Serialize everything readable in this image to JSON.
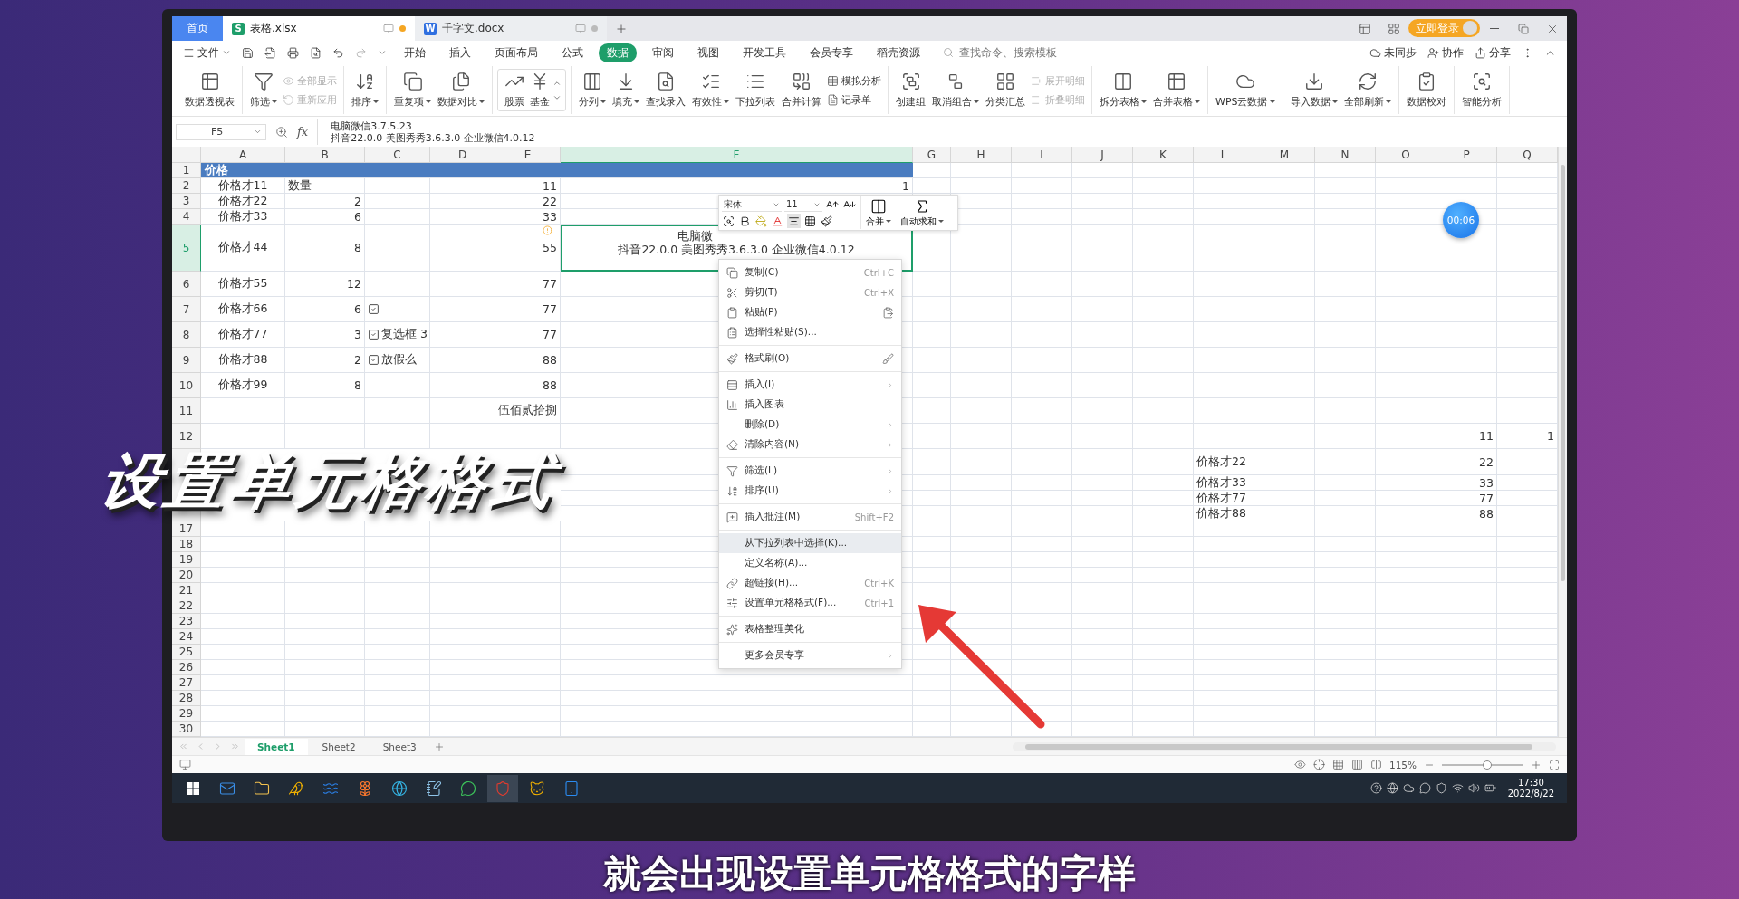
{
  "title_bar": {
    "tabs": [
      {
        "label": "首页",
        "kind": "home",
        "selected": false
      },
      {
        "label": "表格.xlsx",
        "kind": "doc",
        "badge": "S",
        "selected": true
      },
      {
        "label": "千字文.docx",
        "kind": "doc",
        "badge": "W",
        "selected": false
      }
    ],
    "login_button": "立即登录"
  },
  "menu_bar": {
    "file_label": "文件",
    "tabs": [
      {
        "label": "开始",
        "selected": false
      },
      {
        "label": "插入",
        "selected": false
      },
      {
        "label": "页面布局",
        "selected": false
      },
      {
        "label": "公式",
        "selected": false
      },
      {
        "label": "数据",
        "selected": true
      },
      {
        "label": "审阅",
        "selected": false
      },
      {
        "label": "视图",
        "selected": false
      },
      {
        "label": "开发工具",
        "selected": false
      },
      {
        "label": "会员专享",
        "selected": false
      },
      {
        "label": "稻壳资源",
        "selected": false
      }
    ],
    "search": {
      "placeholder": "查找命令、搜索模板"
    },
    "actions": [
      "未同步",
      "协作",
      "分享"
    ]
  },
  "ribbon": {
    "groups": [
      {
        "kind": "plain",
        "items": [
          {
            "label": "数据透视表",
            "kind": "large",
            "dropdown": false,
            "disabled": false
          }
        ]
      },
      {
        "kind": "plain",
        "items": [
          {
            "label": "筛选",
            "kind": "large",
            "dropdown": true,
            "disabled": false
          },
          {
            "label": "全部显示",
            "kind": "small",
            "dropdown": false,
            "disabled": true
          },
          {
            "label": "重新应用",
            "kind": "small",
            "dropdown": false,
            "disabled": true
          }
        ]
      },
      {
        "kind": "plain",
        "items": [
          {
            "label": "排序",
            "kind": "large",
            "dropdown": true,
            "disabled": false
          }
        ]
      },
      {
        "kind": "plain",
        "items": [
          {
            "label": "重复项",
            "kind": "large",
            "dropdown": true,
            "disabled": false
          },
          {
            "label": "数据对比",
            "kind": "large",
            "dropdown": true,
            "disabled": false
          }
        ]
      },
      {
        "kind": "gallery",
        "items": [
          {
            "label": "股票",
            "kind": "large",
            "dropdown": false,
            "disabled": false
          },
          {
            "label": "基金",
            "kind": "large",
            "dropdown": false,
            "disabled": false
          }
        ]
      },
      {
        "kind": "plain",
        "items": [
          {
            "label": "分列",
            "kind": "large",
            "dropdown": true,
            "disabled": false
          },
          {
            "label": "填充",
            "kind": "large",
            "dropdown": true,
            "disabled": false
          },
          {
            "label": "查找录入",
            "kind": "large",
            "dropdown": false,
            "disabled": false
          },
          {
            "label": "有效性",
            "kind": "large",
            "dropdown": true,
            "disabled": false
          },
          {
            "label": "下拉列表",
            "kind": "large",
            "dropdown": false,
            "disabled": false
          },
          {
            "label": "合并计算",
            "kind": "large",
            "dropdown": false,
            "disabled": false
          },
          {
            "label": "模拟分析",
            "kind": "small",
            "dropdown": false,
            "disabled": false
          },
          {
            "label": "记录单",
            "kind": "small",
            "dropdown": false,
            "disabled": false
          }
        ]
      },
      {
        "kind": "plain",
        "items": [
          {
            "label": "创建组",
            "kind": "large",
            "dropdown": false,
            "disabled": false
          },
          {
            "label": "取消组合",
            "kind": "large",
            "dropdown": true,
            "disabled": false
          },
          {
            "label": "分类汇总",
            "kind": "large",
            "dropdown": false,
            "disabled": false
          },
          {
            "label": "展开明细",
            "kind": "small",
            "dropdown": false,
            "disabled": true
          },
          {
            "label": "折叠明细",
            "kind": "small",
            "dropdown": false,
            "disabled": true
          }
        ]
      },
      {
        "kind": "plain",
        "items": [
          {
            "label": "拆分表格",
            "kind": "large",
            "dropdown": true,
            "disabled": false
          },
          {
            "label": "合并表格",
            "kind": "large",
            "dropdown": true,
            "disabled": false
          }
        ]
      },
      {
        "kind": "plain",
        "items": [
          {
            "label": "WPS云数据",
            "kind": "large",
            "dropdown": true,
            "disabled": false
          }
        ]
      },
      {
        "kind": "plain",
        "items": [
          {
            "label": "导入数据",
            "kind": "large",
            "dropdown": true,
            "disabled": false
          },
          {
            "label": "全部刷新",
            "kind": "large",
            "dropdown": true,
            "disabled": false
          }
        ]
      },
      {
        "kind": "plain",
        "items": [
          {
            "label": "数据校对",
            "kind": "large",
            "dropdown": false,
            "disabled": false
          }
        ]
      },
      {
        "kind": "plain",
        "items": [
          {
            "label": "智能分析",
            "kind": "large",
            "dropdown": false,
            "disabled": false
          }
        ]
      }
    ]
  },
  "formula_bar": {
    "cell_ref": "F5",
    "fx": "fx",
    "lines": [
      "电脑微信3.7.5.23",
      "抖音22.0.0 美图秀秀3.6.3.0 企业微信4.0.12"
    ]
  },
  "sheet": {
    "columns": [
      {
        "label": "A",
        "selected": false
      },
      {
        "label": "B",
        "selected": false
      },
      {
        "label": "C",
        "selected": false
      },
      {
        "label": "D",
        "selected": false
      },
      {
        "label": "E",
        "selected": false
      },
      {
        "label": "F",
        "selected": true
      },
      {
        "label": "G",
        "selected": false
      },
      {
        "label": "H",
        "selected": false
      },
      {
        "label": "I",
        "selected": false
      },
      {
        "label": "J",
        "selected": false
      },
      {
        "label": "K",
        "selected": false
      },
      {
        "label": "L",
        "selected": false
      },
      {
        "label": "M",
        "selected": false
      },
      {
        "label": "N",
        "selected": false
      },
      {
        "label": "O",
        "selected": false
      },
      {
        "label": "P",
        "selected": false
      },
      {
        "label": "Q",
        "selected": false
      }
    ],
    "rows": [
      {
        "number": "1",
        "selected": false,
        "cells": [
          {
            "kind": "banner",
            "text": "价格"
          }
        ]
      },
      {
        "number": "2",
        "selected": false,
        "cells": [
          {
            "kind": "label",
            "text": "价格才11"
          },
          {
            "kind": "text",
            "text": "数量"
          },
          {
            "kind": "empty"
          },
          {
            "kind": "empty"
          },
          {
            "kind": "number",
            "text": "11"
          },
          {
            "kind": "number",
            "text": "1"
          }
        ]
      },
      {
        "number": "3",
        "selected": false,
        "cells": [
          {
            "kind": "label",
            "text": "价格才22"
          },
          {
            "kind": "number",
            "text": "2"
          },
          {
            "kind": "empty"
          },
          {
            "kind": "empty"
          },
          {
            "kind": "number",
            "text": "22"
          }
        ]
      },
      {
        "number": "4",
        "selected": false,
        "cells": [
          {
            "kind": "label",
            "text": "价格才33"
          },
          {
            "kind": "number",
            "text": "6"
          },
          {
            "kind": "empty"
          },
          {
            "kind": "empty"
          },
          {
            "kind": "number",
            "text": "33"
          }
        ]
      },
      {
        "number": "5",
        "selected": true,
        "cells": [
          {
            "kind": "label",
            "text": "价格才44"
          },
          {
            "kind": "number",
            "text": "8"
          },
          {
            "kind": "empty"
          },
          {
            "kind": "empty"
          },
          {
            "kind": "number",
            "text": "55",
            "warning": true
          },
          {
            "kind": "multiline",
            "lines": [
              "电脑微",
              "抖音22.0.0 美图秀秀3.6.3.0 企业微信4.0.12"
            ]
          }
        ]
      },
      {
        "number": "6",
        "selected": false,
        "cells": [
          {
            "kind": "label",
            "text": "价格才55"
          },
          {
            "kind": "number",
            "text": "12"
          },
          {
            "kind": "empty"
          },
          {
            "kind": "empty"
          },
          {
            "kind": "number",
            "text": "77"
          }
        ]
      },
      {
        "number": "7",
        "selected": false,
        "cells": [
          {
            "kind": "label",
            "text": "价格才66"
          },
          {
            "kind": "number",
            "text": "6"
          },
          {
            "kind": "checkbox",
            "checked": true
          },
          {
            "kind": "empty"
          },
          {
            "kind": "number",
            "text": "77"
          }
        ]
      },
      {
        "number": "8",
        "selected": false,
        "cells": [
          {
            "kind": "label",
            "text": "价格才77"
          },
          {
            "kind": "number",
            "text": "3"
          },
          {
            "kind": "checkbox",
            "checked": true,
            "text": "复选框 3"
          },
          {
            "kind": "empty"
          },
          {
            "kind": "number",
            "text": "77"
          }
        ]
      },
      {
        "number": "9",
        "selected": false,
        "cells": [
          {
            "kind": "label",
            "text": "价格才88"
          },
          {
            "kind": "number",
            "text": "2"
          },
          {
            "kind": "checkbox",
            "checked": true,
            "text": "放假么"
          },
          {
            "kind": "empty"
          },
          {
            "kind": "number",
            "text": "88"
          }
        ]
      },
      {
        "number": "10",
        "selected": false,
        "cells": [
          {
            "kind": "label",
            "text": "价格才99"
          },
          {
            "kind": "number",
            "text": "8"
          },
          {
            "kind": "empty"
          },
          {
            "kind": "empty"
          },
          {
            "kind": "number",
            "text": "88"
          }
        ]
      },
      {
        "number": "11",
        "selected": false,
        "cells": [
          {
            "kind": "empty"
          },
          {
            "kind": "empty"
          },
          {
            "kind": "empty"
          },
          {
            "kind": "empty"
          },
          {
            "kind": "number",
            "text": "伍佰贰拾捌"
          }
        ]
      },
      {
        "number": "12",
        "selected": false,
        "cells": [
          {
            "kind": "empty"
          },
          {
            "kind": "empty"
          },
          {
            "kind": "empty"
          },
          {
            "kind": "empty"
          },
          {
            "kind": "empty"
          },
          {
            "kind": "empty"
          },
          {
            "kind": "empty"
          },
          {
            "kind": "empty"
          },
          {
            "kind": "empty"
          },
          {
            "kind": "empty"
          },
          {
            "kind": "empty"
          },
          {
            "kind": "empty"
          },
          {
            "kind": "empty"
          },
          {
            "kind": "empty"
          },
          {
            "kind": "empty"
          },
          {
            "kind": "number",
            "text": "11"
          },
          {
            "kind": "number",
            "text": "1"
          }
        ]
      },
      {
        "selected": false,
        "cells": [
          {
            "kind": "empty"
          },
          {
            "kind": "empty"
          },
          {
            "kind": "empty"
          },
          {
            "kind": "empty"
          },
          {
            "kind": "empty"
          },
          {
            "kind": "empty"
          },
          {
            "kind": "empty"
          },
          {
            "kind": "empty"
          },
          {
            "kind": "empty"
          },
          {
            "kind": "empty"
          },
          {
            "kind": "empty"
          },
          {
            "kind": "text",
            "text": "价格才22"
          },
          {
            "kind": "empty"
          },
          {
            "kind": "empty"
          },
          {
            "kind": "empty"
          },
          {
            "kind": "number",
            "text": "22"
          }
        ]
      },
      {
        "selected": false,
        "cells": [
          {
            "kind": "empty"
          },
          {
            "kind": "empty"
          },
          {
            "kind": "empty"
          },
          {
            "kind": "empty"
          },
          {
            "kind": "empty"
          },
          {
            "kind": "empty"
          },
          {
            "kind": "empty"
          },
          {
            "kind": "empty"
          },
          {
            "kind": "empty"
          },
          {
            "kind": "empty"
          },
          {
            "kind": "empty"
          },
          {
            "kind": "text",
            "text": "价格才33"
          },
          {
            "kind": "empty"
          },
          {
            "kind": "empty"
          },
          {
            "kind": "empty"
          },
          {
            "kind": "number",
            "text": "33"
          }
        ]
      },
      {
        "selected": false,
        "cells": [
          {
            "kind": "empty"
          },
          {
            "kind": "empty"
          },
          {
            "kind": "empty"
          },
          {
            "kind": "empty"
          },
          {
            "kind": "empty"
          },
          {
            "kind": "empty"
          },
          {
            "kind": "empty"
          },
          {
            "kind": "empty"
          },
          {
            "kind": "empty"
          },
          {
            "kind": "empty"
          },
          {
            "kind": "empty"
          },
          {
            "kind": "text",
            "text": "价格才77"
          },
          {
            "kind": "empty"
          },
          {
            "kind": "empty"
          },
          {
            "kind": "empty"
          },
          {
            "kind": "number",
            "text": "77"
          }
        ]
      },
      {
        "selected": false,
        "cells": [
          {
            "kind": "empty"
          },
          {
            "kind": "empty"
          },
          {
            "kind": "empty"
          },
          {
            "kind": "empty"
          },
          {
            "kind": "empty"
          },
          {
            "kind": "empty"
          },
          {
            "kind": "empty"
          },
          {
            "kind": "empty"
          },
          {
            "kind": "empty"
          },
          {
            "kind": "empty"
          },
          {
            "kind": "empty"
          },
          {
            "kind": "text",
            "text": "价格才88"
          },
          {
            "kind": "empty"
          },
          {
            "kind": "empty"
          },
          {
            "kind": "empty"
          },
          {
            "kind": "number",
            "text": "88"
          }
        ]
      },
      {
        "number": "17",
        "selected": false,
        "cells": []
      },
      {
        "number": "18",
        "selected": false,
        "cells": []
      },
      {
        "number": "19",
        "selected": false,
        "cells": []
      },
      {
        "number": "20",
        "selected": false,
        "cells": []
      },
      {
        "number": "21",
        "selected": false,
        "cells": []
      },
      {
        "number": "22",
        "selected": false,
        "cells": []
      },
      {
        "number": "23",
        "selected": false,
        "cells": []
      },
      {
        "number": "24",
        "selected": false,
        "cells": []
      },
      {
        "number": "25",
        "selected": false,
        "cells": []
      },
      {
        "number": "26",
        "selected": false,
        "cells": []
      },
      {
        "number": "27",
        "selected": false,
        "cells": []
      },
      {
        "number": "28",
        "selected": false,
        "cells": []
      },
      {
        "number": "29",
        "selected": false,
        "cells": []
      },
      {
        "number": "30",
        "selected": false,
        "cells": []
      }
    ]
  },
  "mini_toolbar": {
    "font": "宋体",
    "size": "11",
    "merge": "合并",
    "autosum": "自动求和"
  },
  "context_menu": {
    "sections": [
      [
        {
          "label": "复制(C)",
          "shortcut": "Ctrl+C",
          "submenu": false,
          "selected": false
        },
        {
          "label": "剪切(T)",
          "shortcut": "Ctrl+X",
          "submenu": false,
          "selected": false
        },
        {
          "label": "粘贴(P)",
          "submenu": false,
          "selected": false
        },
        {
          "label": "选择性粘贴(S)...",
          "submenu": false,
          "selected": false
        }
      ],
      [
        {
          "label": "格式刷(O)",
          "submenu": false,
          "selected": false
        }
      ],
      [
        {
          "label": "插入(I)",
          "submenu": true,
          "selected": false
        },
        {
          "label": "插入图表",
          "submenu": false,
          "selected": false
        },
        {
          "label": "删除(D)",
          "submenu": true,
          "selected": false
        },
        {
          "label": "清除内容(N)",
          "submenu": true,
          "selected": false
        }
      ],
      [
        {
          "label": "筛选(L)",
          "submenu": true,
          "selected": false
        },
        {
          "label": "排序(U)",
          "submenu": true,
          "selected": false
        }
      ],
      [
        {
          "label": "插入批注(M)",
          "shortcut": "Shift+F2",
          "submenu": false,
          "selected": false
        }
      ],
      [
        {
          "label": "从下拉列表中选择(K)...",
          "submenu": false,
          "selected": true
        },
        {
          "label": "定义名称(A)...",
          "submenu": false,
          "selected": false
        },
        {
          "label": "超链接(H)...",
          "shortcut": "Ctrl+K",
          "submenu": false,
          "selected": false
        },
        {
          "label": "设置单元格格式(F)...",
          "shortcut": "Ctrl+1",
          "submenu": false,
          "selected": false
        }
      ],
      [
        {
          "label": "表格整理美化",
          "submenu": false,
          "selected": false
        }
      ],
      [
        {
          "label": "更多会员专享",
          "submenu": true,
          "selected": false
        }
      ]
    ]
  },
  "timer": "00:06",
  "sheet_tabs": [
    {
      "label": "Sheet1",
      "selected": true
    },
    {
      "label": "Sheet2",
      "selected": false
    },
    {
      "label": "Sheet3",
      "selected": false
    }
  ],
  "status_bar": {
    "zoom": "115%",
    "level": 0.55
  },
  "taskbar": {
    "time": "17:30",
    "date": "2022/8/22"
  },
  "caption_overlay": "设置单元格格式",
  "subtitle": "就会出现设置单元格格式的字样"
}
